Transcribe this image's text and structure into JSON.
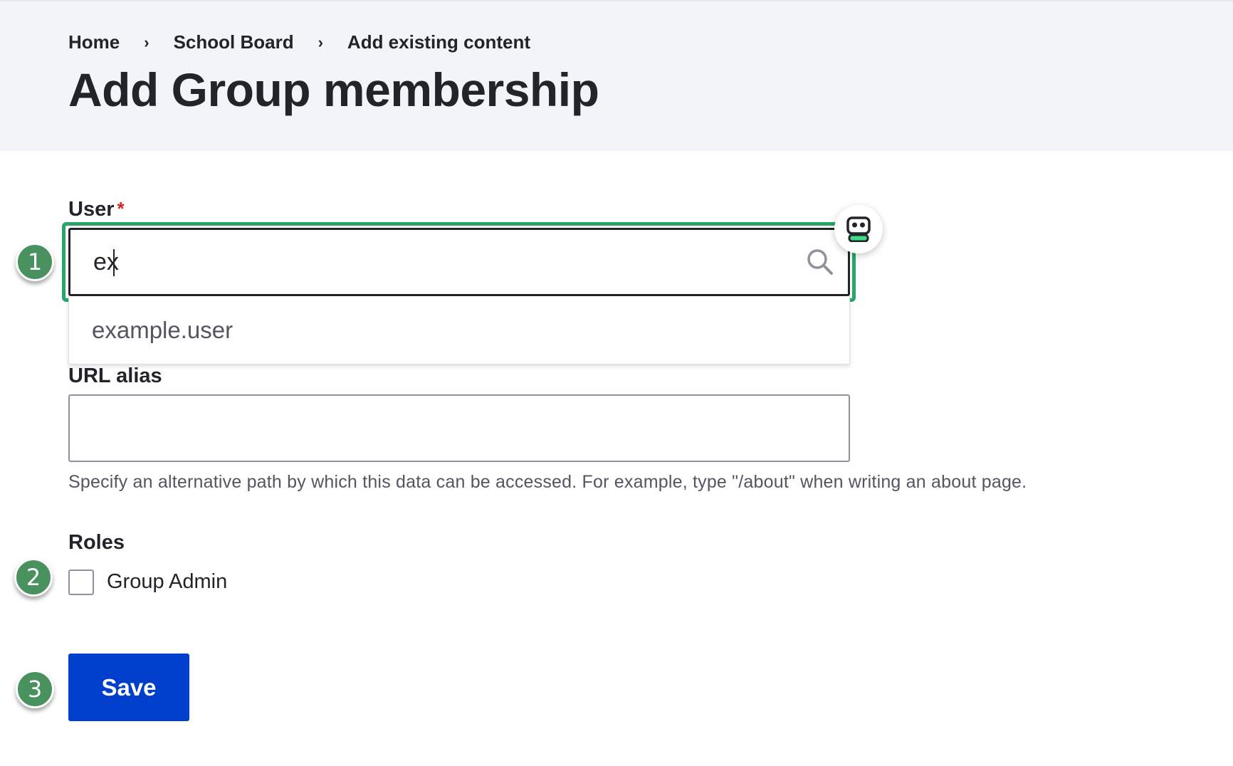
{
  "breadcrumb": {
    "items": [
      "Home",
      "School Board",
      "Add existing content"
    ],
    "separator": "›"
  },
  "page_title": "Add Group membership",
  "user_field": {
    "label": "User",
    "required_marker": "*",
    "value": "ex",
    "suggestions": [
      "example.user"
    ]
  },
  "url_alias": {
    "label": "URL alias",
    "value": "",
    "description": "Specify an alternative path by which this data can be accessed. For example, type \"/about\" when writing an about page."
  },
  "roles": {
    "label": "Roles",
    "options": [
      {
        "label": "Group Admin",
        "checked": false
      }
    ]
  },
  "save_label": "Save",
  "step_badges": [
    "1",
    "2",
    "3"
  ],
  "icons": {
    "search": "search-icon",
    "assistant": "robot-icon"
  },
  "colors": {
    "accent_button": "#003ecc",
    "focus_ring": "#26a769",
    "required": "#d72222",
    "badge": "#4a9160"
  }
}
